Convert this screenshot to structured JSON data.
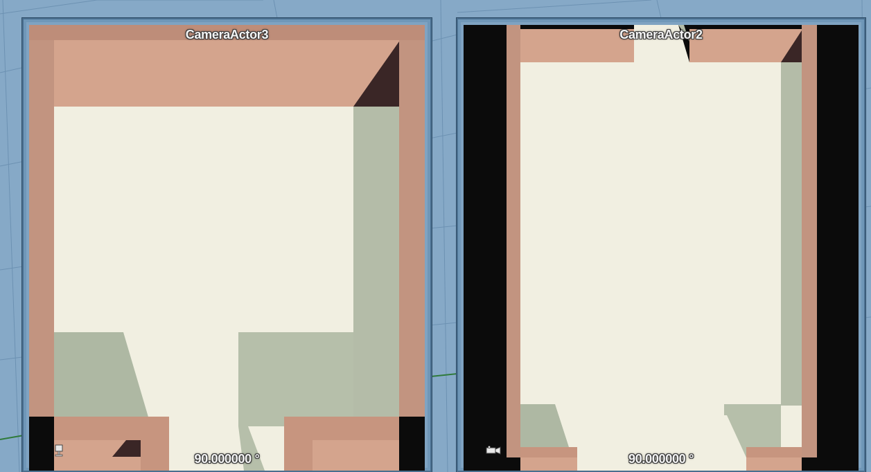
{
  "viewport": {
    "background_color": "#86a9c7",
    "grid_color": "#5f85a6"
  },
  "previews": [
    {
      "camera_name": "CameraActor3",
      "fov_readout": "90.000000 °",
      "icon": "pillar-camera-icon"
    },
    {
      "camera_name": "CameraActor2",
      "fov_readout": "90.000000 °",
      "icon": "movie-camera-icon"
    }
  ],
  "colors": {
    "wall": "#d4a48d",
    "wall_shade": "#bf8f7a",
    "floor": "#f1efe1",
    "shadow": "#b4bca8",
    "dark_corner": "#3a2626",
    "letterbox": "#0b0b0b",
    "frame_border": "#4a6f8f"
  }
}
